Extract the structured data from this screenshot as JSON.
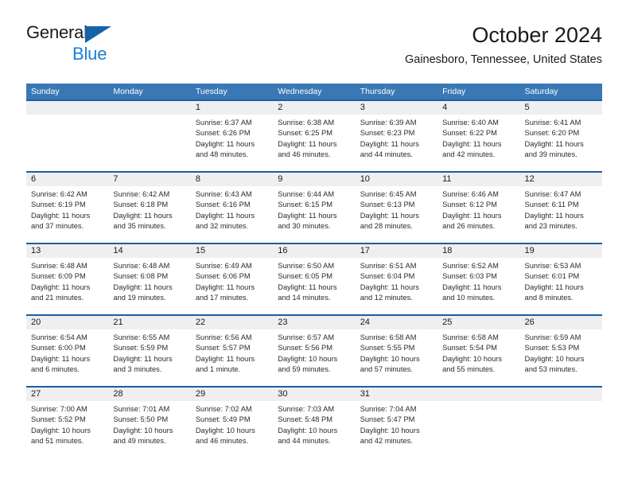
{
  "brand": {
    "name_top": "General",
    "name_bottom": "Blue",
    "accent_color": "#1b7fd4",
    "triangle_color": "#1464a5"
  },
  "header": {
    "title": "October 2024",
    "subtitle": "Gainesboro, Tennessee, United States"
  },
  "theme": {
    "header_blue": "#3a78b5",
    "separator_blue": "#1a5fa0",
    "day_band_gray": "#efefef"
  },
  "weekdays": [
    "Sunday",
    "Monday",
    "Tuesday",
    "Wednesday",
    "Thursday",
    "Friday",
    "Saturday"
  ],
  "weeks": [
    [
      {
        "day": "",
        "empty": true
      },
      {
        "day": "",
        "empty": true
      },
      {
        "day": "1",
        "sunrise": "Sunrise: 6:37 AM",
        "sunset": "Sunset: 6:26 PM",
        "daylight1": "Daylight: 11 hours",
        "daylight2": "and 48 minutes."
      },
      {
        "day": "2",
        "sunrise": "Sunrise: 6:38 AM",
        "sunset": "Sunset: 6:25 PM",
        "daylight1": "Daylight: 11 hours",
        "daylight2": "and 46 minutes."
      },
      {
        "day": "3",
        "sunrise": "Sunrise: 6:39 AM",
        "sunset": "Sunset: 6:23 PM",
        "daylight1": "Daylight: 11 hours",
        "daylight2": "and 44 minutes."
      },
      {
        "day": "4",
        "sunrise": "Sunrise: 6:40 AM",
        "sunset": "Sunset: 6:22 PM",
        "daylight1": "Daylight: 11 hours",
        "daylight2": "and 42 minutes."
      },
      {
        "day": "5",
        "sunrise": "Sunrise: 6:41 AM",
        "sunset": "Sunset: 6:20 PM",
        "daylight1": "Daylight: 11 hours",
        "daylight2": "and 39 minutes."
      }
    ],
    [
      {
        "day": "6",
        "sunrise": "Sunrise: 6:42 AM",
        "sunset": "Sunset: 6:19 PM",
        "daylight1": "Daylight: 11 hours",
        "daylight2": "and 37 minutes."
      },
      {
        "day": "7",
        "sunrise": "Sunrise: 6:42 AM",
        "sunset": "Sunset: 6:18 PM",
        "daylight1": "Daylight: 11 hours",
        "daylight2": "and 35 minutes."
      },
      {
        "day": "8",
        "sunrise": "Sunrise: 6:43 AM",
        "sunset": "Sunset: 6:16 PM",
        "daylight1": "Daylight: 11 hours",
        "daylight2": "and 32 minutes."
      },
      {
        "day": "9",
        "sunrise": "Sunrise: 6:44 AM",
        "sunset": "Sunset: 6:15 PM",
        "daylight1": "Daylight: 11 hours",
        "daylight2": "and 30 minutes."
      },
      {
        "day": "10",
        "sunrise": "Sunrise: 6:45 AM",
        "sunset": "Sunset: 6:13 PM",
        "daylight1": "Daylight: 11 hours",
        "daylight2": "and 28 minutes."
      },
      {
        "day": "11",
        "sunrise": "Sunrise: 6:46 AM",
        "sunset": "Sunset: 6:12 PM",
        "daylight1": "Daylight: 11 hours",
        "daylight2": "and 26 minutes."
      },
      {
        "day": "12",
        "sunrise": "Sunrise: 6:47 AM",
        "sunset": "Sunset: 6:11 PM",
        "daylight1": "Daylight: 11 hours",
        "daylight2": "and 23 minutes."
      }
    ],
    [
      {
        "day": "13",
        "sunrise": "Sunrise: 6:48 AM",
        "sunset": "Sunset: 6:09 PM",
        "daylight1": "Daylight: 11 hours",
        "daylight2": "and 21 minutes."
      },
      {
        "day": "14",
        "sunrise": "Sunrise: 6:48 AM",
        "sunset": "Sunset: 6:08 PM",
        "daylight1": "Daylight: 11 hours",
        "daylight2": "and 19 minutes."
      },
      {
        "day": "15",
        "sunrise": "Sunrise: 6:49 AM",
        "sunset": "Sunset: 6:06 PM",
        "daylight1": "Daylight: 11 hours",
        "daylight2": "and 17 minutes."
      },
      {
        "day": "16",
        "sunrise": "Sunrise: 6:50 AM",
        "sunset": "Sunset: 6:05 PM",
        "daylight1": "Daylight: 11 hours",
        "daylight2": "and 14 minutes."
      },
      {
        "day": "17",
        "sunrise": "Sunrise: 6:51 AM",
        "sunset": "Sunset: 6:04 PM",
        "daylight1": "Daylight: 11 hours",
        "daylight2": "and 12 minutes."
      },
      {
        "day": "18",
        "sunrise": "Sunrise: 6:52 AM",
        "sunset": "Sunset: 6:03 PM",
        "daylight1": "Daylight: 11 hours",
        "daylight2": "and 10 minutes."
      },
      {
        "day": "19",
        "sunrise": "Sunrise: 6:53 AM",
        "sunset": "Sunset: 6:01 PM",
        "daylight1": "Daylight: 11 hours",
        "daylight2": "and 8 minutes."
      }
    ],
    [
      {
        "day": "20",
        "sunrise": "Sunrise: 6:54 AM",
        "sunset": "Sunset: 6:00 PM",
        "daylight1": "Daylight: 11 hours",
        "daylight2": "and 6 minutes."
      },
      {
        "day": "21",
        "sunrise": "Sunrise: 6:55 AM",
        "sunset": "Sunset: 5:59 PM",
        "daylight1": "Daylight: 11 hours",
        "daylight2": "and 3 minutes."
      },
      {
        "day": "22",
        "sunrise": "Sunrise: 6:56 AM",
        "sunset": "Sunset: 5:57 PM",
        "daylight1": "Daylight: 11 hours",
        "daylight2": "and 1 minute."
      },
      {
        "day": "23",
        "sunrise": "Sunrise: 6:57 AM",
        "sunset": "Sunset: 5:56 PM",
        "daylight1": "Daylight: 10 hours",
        "daylight2": "and 59 minutes."
      },
      {
        "day": "24",
        "sunrise": "Sunrise: 6:58 AM",
        "sunset": "Sunset: 5:55 PM",
        "daylight1": "Daylight: 10 hours",
        "daylight2": "and 57 minutes."
      },
      {
        "day": "25",
        "sunrise": "Sunrise: 6:58 AM",
        "sunset": "Sunset: 5:54 PM",
        "daylight1": "Daylight: 10 hours",
        "daylight2": "and 55 minutes."
      },
      {
        "day": "26",
        "sunrise": "Sunrise: 6:59 AM",
        "sunset": "Sunset: 5:53 PM",
        "daylight1": "Daylight: 10 hours",
        "daylight2": "and 53 minutes."
      }
    ],
    [
      {
        "day": "27",
        "sunrise": "Sunrise: 7:00 AM",
        "sunset": "Sunset: 5:52 PM",
        "daylight1": "Daylight: 10 hours",
        "daylight2": "and 51 minutes."
      },
      {
        "day": "28",
        "sunrise": "Sunrise: 7:01 AM",
        "sunset": "Sunset: 5:50 PM",
        "daylight1": "Daylight: 10 hours",
        "daylight2": "and 49 minutes."
      },
      {
        "day": "29",
        "sunrise": "Sunrise: 7:02 AM",
        "sunset": "Sunset: 5:49 PM",
        "daylight1": "Daylight: 10 hours",
        "daylight2": "and 46 minutes."
      },
      {
        "day": "30",
        "sunrise": "Sunrise: 7:03 AM",
        "sunset": "Sunset: 5:48 PM",
        "daylight1": "Daylight: 10 hours",
        "daylight2": "and 44 minutes."
      },
      {
        "day": "31",
        "sunrise": "Sunrise: 7:04 AM",
        "sunset": "Sunset: 5:47 PM",
        "daylight1": "Daylight: 10 hours",
        "daylight2": "and 42 minutes."
      },
      {
        "day": "",
        "empty": true
      },
      {
        "day": "",
        "empty": true
      }
    ]
  ]
}
